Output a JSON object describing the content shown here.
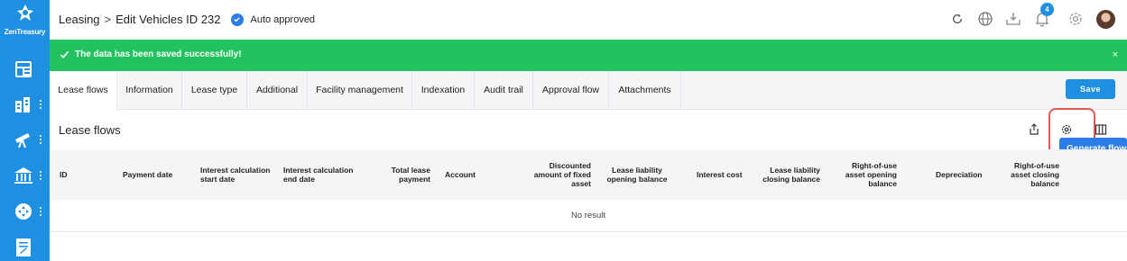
{
  "app": {
    "logo_text": "ZenTreasury"
  },
  "sidebar": {
    "items": [
      {
        "icon": "dashboard-icon"
      },
      {
        "icon": "building-chart-icon"
      },
      {
        "icon": "telescope-icon"
      },
      {
        "icon": "bank-icon"
      },
      {
        "icon": "move-arrows-icon"
      },
      {
        "icon": "document-edit-icon"
      }
    ]
  },
  "header": {
    "breadcrumb_root": "Leasing",
    "breadcrumb_separator": ">",
    "breadcrumb_current": "Edit Vehicles ID 232",
    "status": "Auto approved",
    "notification_count": "4",
    "icons": [
      "refresh-icon",
      "globe-icon",
      "inbox-download-icon",
      "bell-icon",
      "settings-icon"
    ]
  },
  "banner": {
    "message": "The data has been saved successfully!",
    "close": "×",
    "color": "#22c35e"
  },
  "tabs": {
    "items": [
      "Lease flows",
      "Information",
      "Lease type",
      "Additional",
      "Facility management",
      "Indexation",
      "Audit trail",
      "Approval flow",
      "Attachments"
    ],
    "active": "Lease flows",
    "save_label": "Save"
  },
  "section": {
    "title": "Lease flows",
    "tooltip": "Generate flows"
  },
  "table": {
    "columns": [
      "ID",
      "Payment date",
      "Interest calculation start date",
      "Interest calculation end date",
      "Total lease payment",
      "Account",
      "Discounted amount of fixed asset",
      "Lease liability opening balance",
      "Interest cost",
      "Lease liability closing balance",
      "Right-of-use asset opening balance",
      "Depreciation",
      "Right-of-use asset closing balance"
    ],
    "empty_text": "No result"
  },
  "colors": {
    "accent": "#1e8fe1",
    "highlight": "#e0574f"
  }
}
